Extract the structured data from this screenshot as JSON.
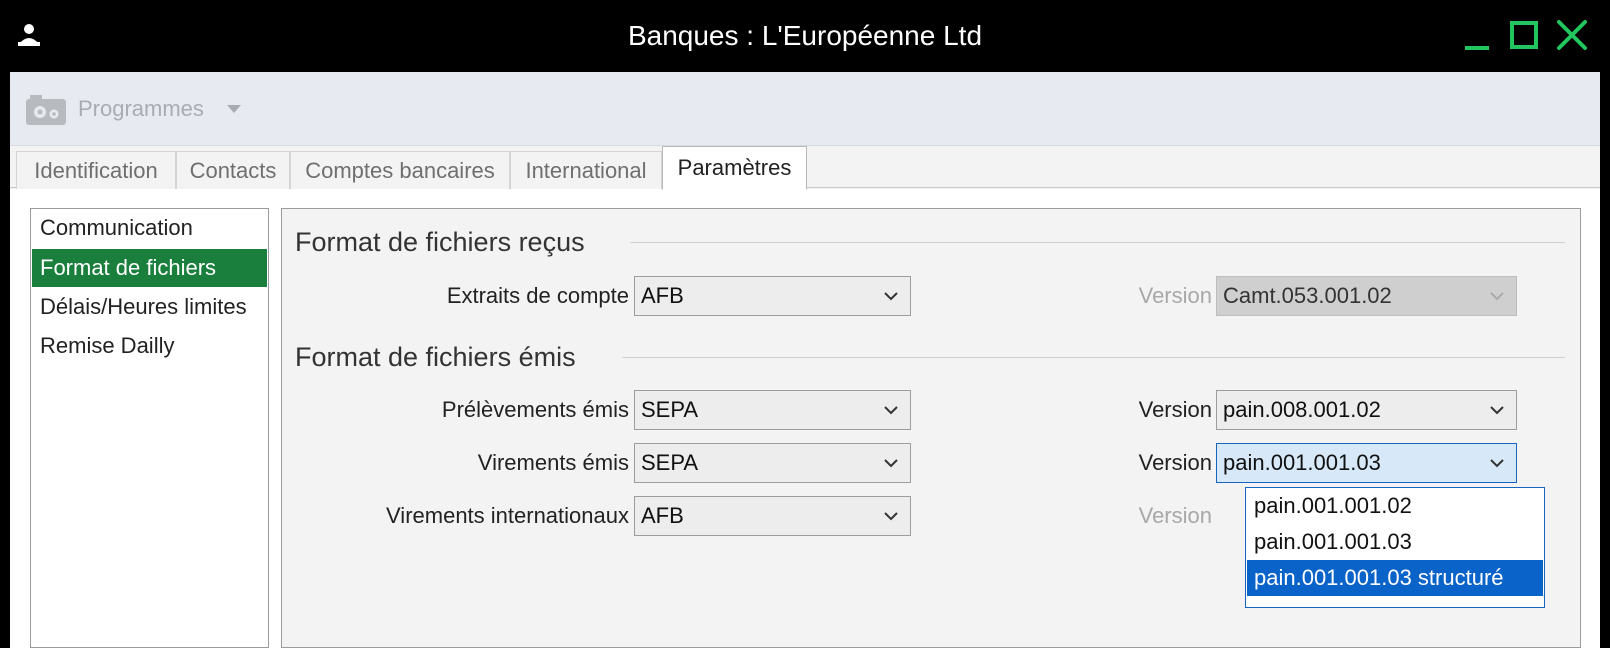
{
  "window": {
    "title": "Banques : L'Européenne Ltd",
    "icons": {
      "app": "user-download-icon",
      "minimize": "minimize-icon",
      "maximize": "maximize-icon",
      "close": "close-icon"
    },
    "accent_color": "#22c55e"
  },
  "toolbar": {
    "programmes_label": "Programmes",
    "icon": "gears-icon"
  },
  "tabs": [
    {
      "label": "Identification",
      "active": false
    },
    {
      "label": "Contacts",
      "active": false
    },
    {
      "label": "Comptes bancaires",
      "active": false
    },
    {
      "label": "International",
      "active": false
    },
    {
      "label": "Paramètres",
      "active": true
    }
  ],
  "nav": {
    "items": [
      {
        "label": "Communication",
        "active": false
      },
      {
        "label": "Format de fichiers",
        "active": true
      },
      {
        "label": "Délais/Heures limites",
        "active": false
      },
      {
        "label": "Remise Dailly",
        "active": false
      }
    ],
    "active_color": "#1a7f3c"
  },
  "received": {
    "title": "Format de fichiers reçus",
    "rows": [
      {
        "label": "Extraits de compte",
        "value": "AFB",
        "version_label": "Version",
        "version_value": "Camt.053.001.02",
        "version_enabled": false
      }
    ]
  },
  "emitted": {
    "title": "Format de fichiers émis",
    "rows": [
      {
        "label": "Prélèvements émis",
        "value": "SEPA",
        "version_label": "Version",
        "version_value": "pain.008.001.02",
        "version_enabled": true
      },
      {
        "label": "Virements émis",
        "value": "SEPA",
        "version_label": "Version",
        "version_value": "pain.001.001.03",
        "version_enabled": true,
        "focused": true
      },
      {
        "label": "Virements internationaux",
        "value": "AFB",
        "version_label": "Version",
        "version_value": "",
        "version_enabled": false
      }
    ]
  },
  "dropdown": {
    "options": [
      "pain.001.001.02",
      "pain.001.001.03",
      "pain.001.001.03 structuré"
    ],
    "selected_index": 2,
    "highlight_color": "#0a63c9"
  }
}
